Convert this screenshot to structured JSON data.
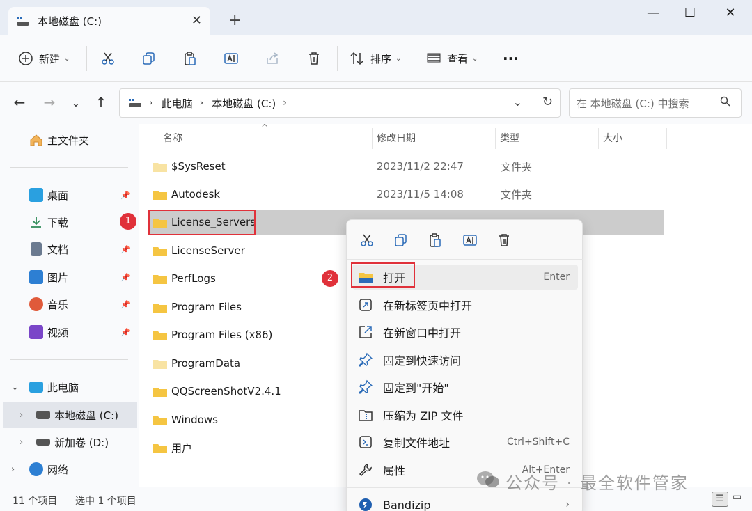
{
  "window": {
    "tab_title": "本地磁盘 (C:)",
    "new_tab": "+",
    "minimize": "—",
    "maximize": "☐",
    "close": "✕"
  },
  "toolbar": {
    "new_label": "新建",
    "sort_label": "排序",
    "view_label": "查看",
    "more_label": "···"
  },
  "address": {
    "crumbs": [
      "此电脑",
      "本地磁盘 (C:)"
    ],
    "search_placeholder": "在 本地磁盘 (C:) 中搜索"
  },
  "sidebar": {
    "home": "主文件夹",
    "quick": [
      {
        "label": "桌面",
        "icon": "desktop-icon",
        "color": "#2aa0e0"
      },
      {
        "label": "下载",
        "icon": "download-icon",
        "color": "#2e8b57"
      },
      {
        "label": "文档",
        "icon": "document-icon",
        "color": "#6b7a90"
      },
      {
        "label": "图片",
        "icon": "pictures-icon",
        "color": "#2d7fd3"
      },
      {
        "label": "音乐",
        "icon": "music-icon",
        "color": "#e05a3a"
      },
      {
        "label": "视频",
        "icon": "video-icon",
        "color": "#7a46c8"
      }
    ],
    "this_pc": "此电脑",
    "drive_c": "本地磁盘 (C:)",
    "drive_d": "新加卷 (D:)",
    "network": "网络"
  },
  "columns": {
    "name": "名称",
    "date": "修改日期",
    "type": "类型",
    "size": "大小"
  },
  "files": [
    {
      "name": "$SysReset",
      "date": "2023/11/2 22:47",
      "type": "文件夹"
    },
    {
      "name": "Autodesk",
      "date": "2023/11/5 14:08",
      "type": "文件夹"
    },
    {
      "name": "License_Servers",
      "date": "",
      "type": ""
    },
    {
      "name": "LicenseServer",
      "date": "",
      "type": ""
    },
    {
      "name": "PerfLogs",
      "date": "",
      "type": ""
    },
    {
      "name": "Program Files",
      "date": "",
      "type": ""
    },
    {
      "name": "Program Files (x86)",
      "date": "",
      "type": ""
    },
    {
      "name": "ProgramData",
      "date": "",
      "type": ""
    },
    {
      "name": "QQScreenShotV2.4.1",
      "date": "",
      "type": ""
    },
    {
      "name": "Windows",
      "date": "",
      "type": ""
    },
    {
      "name": "用户",
      "date": "",
      "type": ""
    }
  ],
  "status": {
    "count": "11 个项目",
    "selected": "选中 1 个项目"
  },
  "context_menu": {
    "items": [
      {
        "label": "打开",
        "shortcut": "Enter",
        "icon": "folder-open-icon"
      },
      {
        "label": "在新标签页中打开",
        "shortcut": "",
        "icon": "new-tab-icon"
      },
      {
        "label": "在新窗口中打开",
        "shortcut": "",
        "icon": "new-window-icon"
      },
      {
        "label": "固定到快速访问",
        "shortcut": "",
        "icon": "pin-icon"
      },
      {
        "label": "固定到\"开始\"",
        "shortcut": "",
        "icon": "pin-start-icon"
      },
      {
        "label": "压缩为 ZIP 文件",
        "shortcut": "",
        "icon": "zip-icon"
      },
      {
        "label": "复制文件地址",
        "shortcut": "Ctrl+Shift+C",
        "icon": "copy-path-icon"
      },
      {
        "label": "属性",
        "shortcut": "Alt+Enter",
        "icon": "wrench-icon"
      },
      {
        "label": "Bandizip",
        "shortcut": "›",
        "icon": "bandizip-icon"
      }
    ]
  },
  "annotations": {
    "step1": "1",
    "step2": "2"
  },
  "watermark": "公众号 · 最全软件管家",
  "colors": {
    "accent": "#e0313a",
    "folder": "#f5c542",
    "selected_row": "#cccccc"
  }
}
